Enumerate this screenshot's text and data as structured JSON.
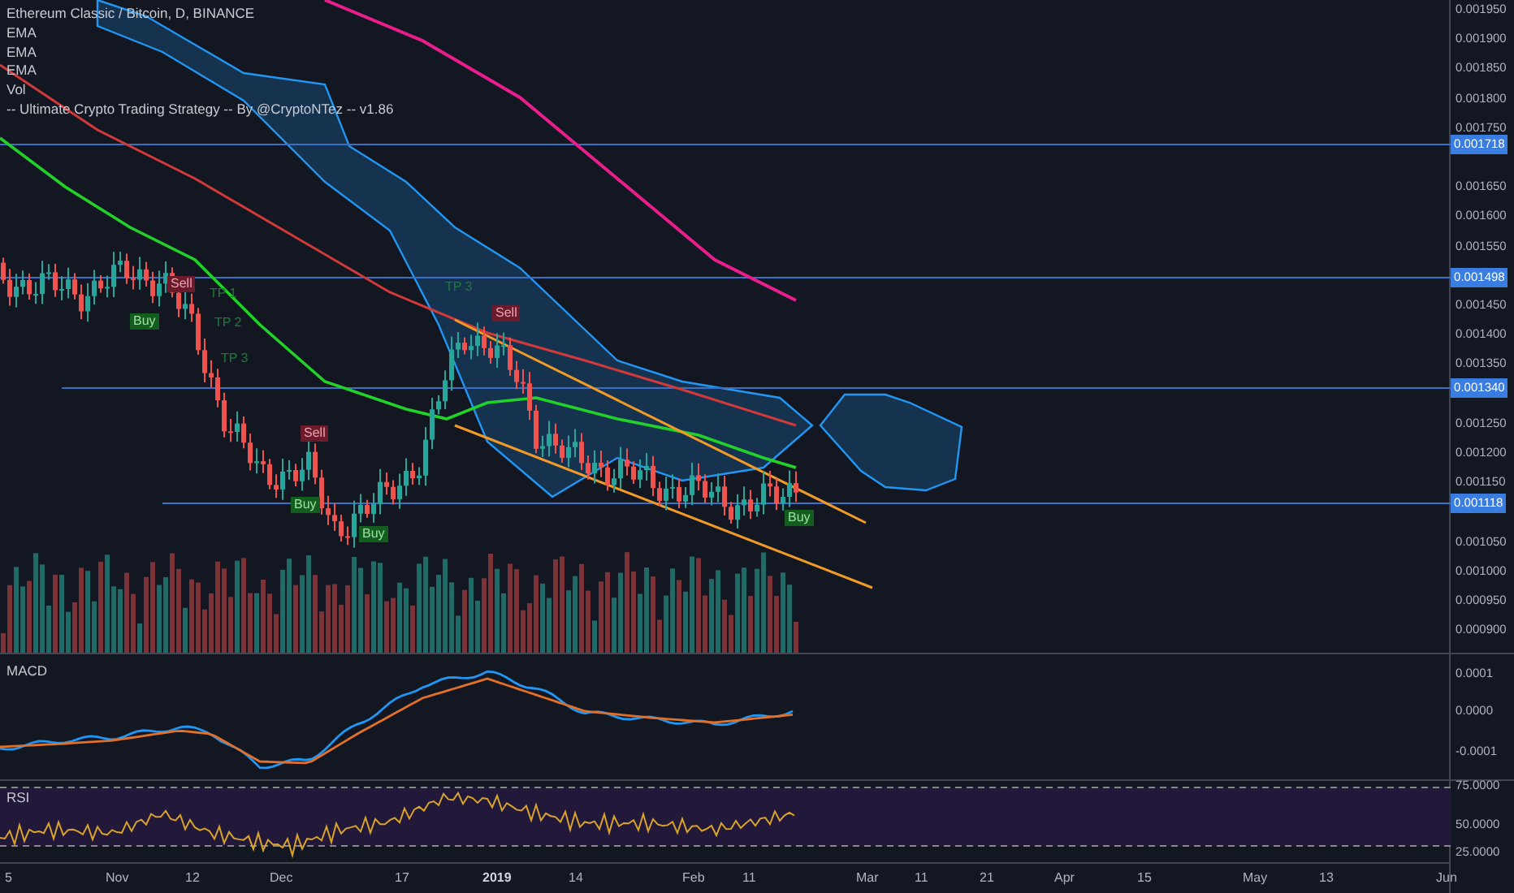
{
  "legend": {
    "title": "Ethereum Classic / Bitcoin, D, BINANCE",
    "indicators": [
      "EMA",
      "EMA",
      "EMA",
      "Vol",
      "-- Ultimate Crypto Trading Strategy -- By @CryptoNTez -- v1.86"
    ]
  },
  "price_axis": [
    "0.001950",
    "0.001900",
    "0.001850",
    "0.001800",
    "0.001750",
    "0.001650",
    "0.001600",
    "0.001550",
    "0.001450",
    "0.001400",
    "0.001350",
    "0.001250",
    "0.001200",
    "0.001150",
    "0.001050",
    "0.001000",
    "0.000950",
    "0.000900"
  ],
  "price_lines": [
    {
      "label": "0.001718"
    },
    {
      "label": "0.001498"
    },
    {
      "label": "0.001340"
    },
    {
      "label": "0.001118"
    }
  ],
  "signals": [
    {
      "label": "Sell",
      "kind": "sell"
    },
    {
      "label": "Buy",
      "kind": "buy"
    },
    {
      "label": "TP 1",
      "kind": "tp"
    },
    {
      "label": "TP 2",
      "kind": "tp"
    },
    {
      "label": "TP 3",
      "kind": "tp"
    },
    {
      "label": "Sell",
      "kind": "sell"
    },
    {
      "label": "Buy",
      "kind": "buy"
    },
    {
      "label": "Buy",
      "kind": "buy"
    },
    {
      "label": "TP 3",
      "kind": "tp"
    },
    {
      "label": "Sell",
      "kind": "sell"
    },
    {
      "label": "Buy",
      "kind": "buy"
    }
  ],
  "macd": {
    "title": "MACD",
    "axis": [
      "0.0001",
      "0.0000",
      "-0.0001"
    ]
  },
  "rsi": {
    "title": "RSI",
    "axis": [
      "75.0000",
      "50.0000",
      "25.0000"
    ]
  },
  "time_axis": [
    {
      "label": "5",
      "kind": "day"
    },
    {
      "label": "Nov",
      "kind": "month"
    },
    {
      "label": "12",
      "kind": "day"
    },
    {
      "label": "Dec",
      "kind": "month"
    },
    {
      "label": "17",
      "kind": "day"
    },
    {
      "label": "2019",
      "kind": "year"
    },
    {
      "label": "14",
      "kind": "day"
    },
    {
      "label": "Feb",
      "kind": "month"
    },
    {
      "label": "11",
      "kind": "day"
    },
    {
      "label": "Mar",
      "kind": "month"
    },
    {
      "label": "11",
      "kind": "day"
    },
    {
      "label": "21",
      "kind": "day"
    },
    {
      "label": "Apr",
      "kind": "month"
    },
    {
      "label": "15",
      "kind": "day"
    },
    {
      "label": "May",
      "kind": "month"
    },
    {
      "label": "13",
      "kind": "day"
    },
    {
      "label": "Jun",
      "kind": "month"
    }
  ]
}
